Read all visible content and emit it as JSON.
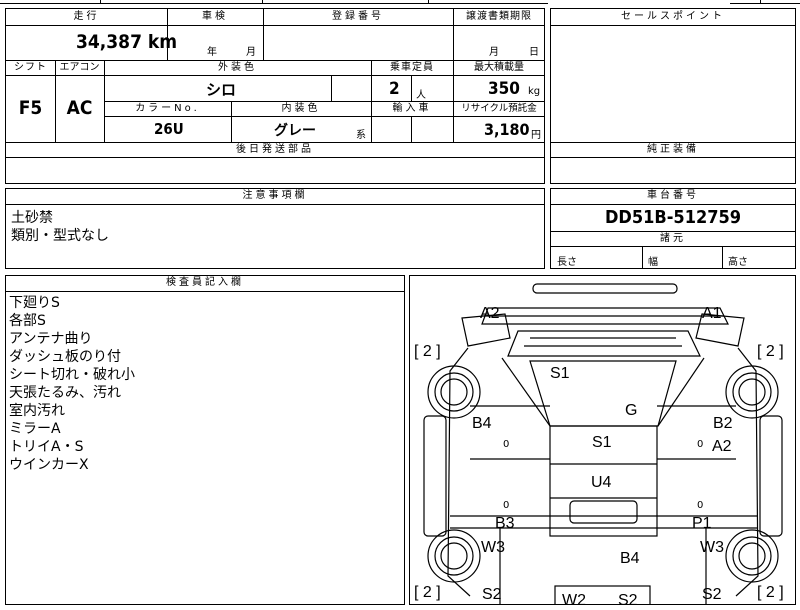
{
  "sheet": {
    "top_header_fragment": "",
    "mileage": {
      "label": "走行",
      "value": "34,387",
      "unit": "km"
    },
    "inspection": {
      "label": "車検",
      "year_unit": "年",
      "month_unit": "月"
    },
    "registration": {
      "label": "登録番号"
    },
    "transfer_deadline": {
      "label": "譲渡書類期限",
      "month_unit": "月",
      "day_unit": "日"
    },
    "shift": {
      "label": "シフト",
      "value": "F5"
    },
    "aircon": {
      "label": "エアコン",
      "value": "AC"
    },
    "exterior_color": {
      "label": "外装色",
      "value": "シロ"
    },
    "capacity": {
      "label": "乗車定員",
      "value": "2",
      "unit": "人"
    },
    "max_load": {
      "label": "最大積載量",
      "value": "350",
      "unit": "kg"
    },
    "color_no": {
      "label": "カラーNo.",
      "value": "26U"
    },
    "interior_color": {
      "label": "内装色",
      "value": "グレー",
      "suffix": "系"
    },
    "import_car": {
      "label": "輸入車"
    },
    "recycle_fee": {
      "label": "リサイクル預託金",
      "value": "3,180",
      "unit": "円"
    },
    "later_parts": {
      "label": "後日発送部品"
    },
    "notes": {
      "label": "注意事項欄",
      "lines": [
        "土砂禁",
        "類別・型式なし"
      ]
    },
    "sales_points": {
      "label": "セールスポイント"
    },
    "genuine_equipment": {
      "label": "純正装備"
    },
    "chassis": {
      "label": "車台番号",
      "value": "DD51B-512759"
    },
    "dimensions": {
      "label": "諸元",
      "length": "長さ",
      "width": "幅",
      "height": "高さ"
    },
    "inspector": {
      "label": "検査員記入欄",
      "lines": [
        "下廻りS",
        "各部S",
        "アンテナ曲り",
        "ダッシュ板のり付",
        "シート切れ・破れ小",
        "天張たるみ、汚れ",
        "室内汚れ",
        "ミラーA",
        "トリイA・S",
        "ウインカーX"
      ]
    }
  },
  "diagram": {
    "tread_marks": {
      "front_left": "[ 2 ]",
      "front_right": "[ 2 ]",
      "rear_left": "[ 2 ]",
      "rear_right": "[ 2 ]"
    },
    "labels": {
      "a2_top": "A2",
      "a1": "A1",
      "s1_roof": "S1",
      "g": "G",
      "b4_left": "B4",
      "b2": "B2",
      "s1_floor": "S1",
      "a2_right": "A2",
      "u4": "U4",
      "b3": "B3",
      "p1": "P1",
      "w3_left": "W3",
      "w3_right": "W3",
      "b4_rear": "B4",
      "s2_left": "S2",
      "s2_right": "S2",
      "w2_rear": "W2",
      "s2_rear": "S2"
    },
    "pillar_marks": {
      "left_upper": "0",
      "right_upper": "0",
      "left_lower": "0",
      "right_lower": "0"
    }
  }
}
